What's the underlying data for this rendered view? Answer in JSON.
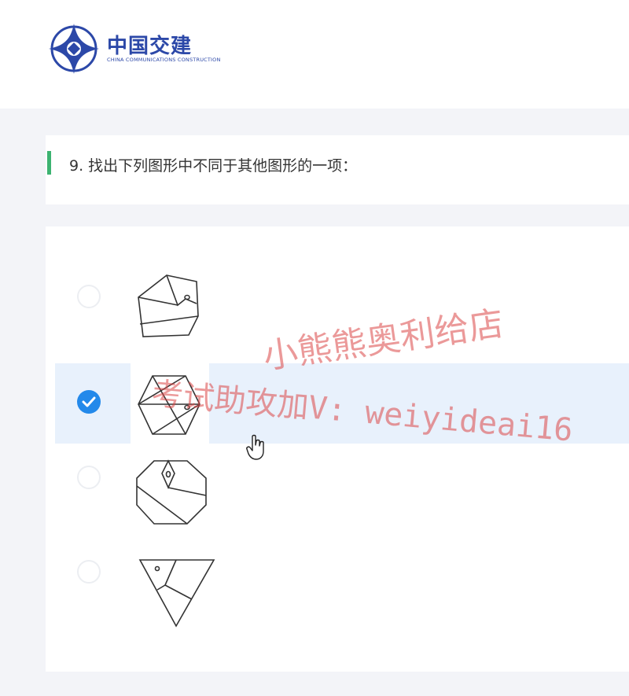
{
  "header": {
    "logo_cn": "中国交建",
    "logo_en": "CHINA COMMUNICATIONS CONSTRUCTION"
  },
  "question": {
    "text": "9.  找出下列图形中不同于其他图形的一项："
  },
  "options": [
    {
      "id": "A",
      "figure": "pentagon-figure",
      "selected": false
    },
    {
      "id": "B",
      "figure": "hexagon-figure",
      "selected": true
    },
    {
      "id": "C",
      "figure": "octagon-figure",
      "selected": false
    },
    {
      "id": "D",
      "figure": "triangle-figure",
      "selected": false
    }
  ],
  "watermark": {
    "line1": "小熊熊奥利给店",
    "line2": "考试助攻加V: weiyideai16"
  },
  "colors": {
    "accent_green": "#3cb371",
    "selected_blue": "#2389ea",
    "selected_row_bg": "#e8f1fc",
    "brand_blue": "#2c48a8",
    "watermark_red": "#da4646"
  }
}
